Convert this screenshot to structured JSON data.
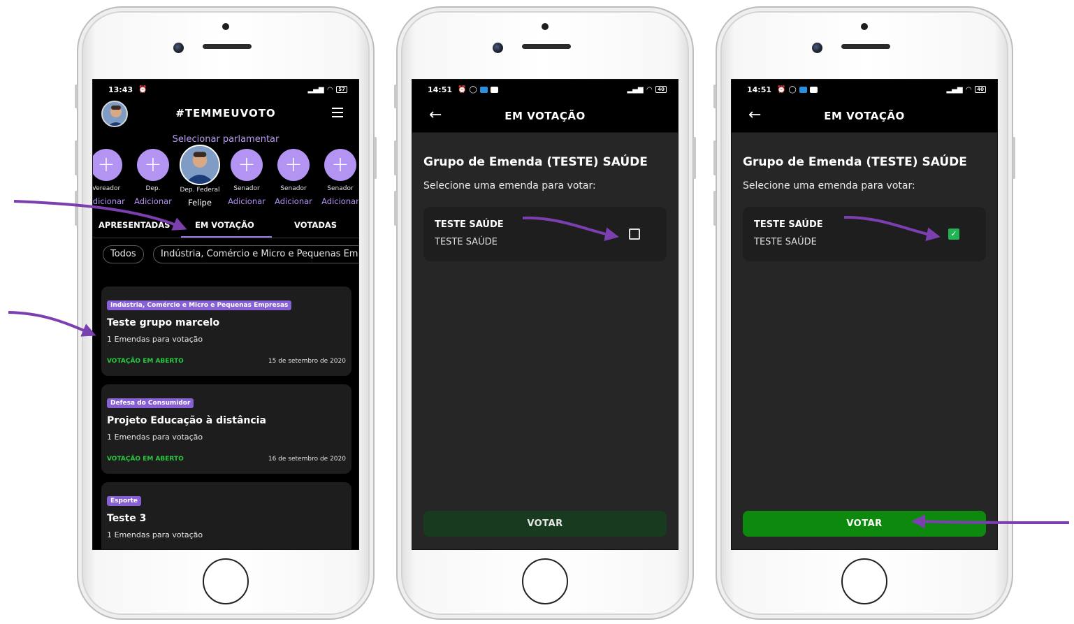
{
  "phone1": {
    "status": {
      "time": "13:43",
      "battery": "57"
    },
    "title": "#TEMMEUVOTO",
    "select_label": "Selecionar parlamentar",
    "parliamentarians": [
      {
        "role": "Vereador",
        "action": "Adicionar"
      },
      {
        "role": "Dep.",
        "action": "Adicionar"
      },
      {
        "role": "Dep. Federal",
        "action": "Felipe"
      },
      {
        "role": "Senador",
        "action": "Adicionar"
      },
      {
        "role": "Senador",
        "action": "Adicionar"
      },
      {
        "role": "Senador",
        "action": "Adicionar"
      }
    ],
    "tabs": [
      "APRESENTADAS",
      "EM VOTAÇÃO",
      "VOTADAS"
    ],
    "chips": [
      "Todos",
      "Indústria, Comércio e Micro e Pequenas Empresas"
    ],
    "cards": [
      {
        "tag": "Indústria, Comércio e Micro e Pequenas Empresas",
        "title": "Teste grupo marcelo",
        "subtitle": "1 Emendas para votação",
        "status": "VOTAÇÃO EM ABERTO",
        "date": "15 de setembro de 2020"
      },
      {
        "tag": "Defesa do Consumidor",
        "title": "Projeto Educação à distância",
        "subtitle": "1 Emendas para votação",
        "status": "VOTAÇÃO EM ABERTO",
        "date": "16 de setembro de 2020"
      },
      {
        "tag": "Esporte",
        "title": "Teste 3",
        "subtitle": "1 Emendas para votação",
        "status": "",
        "date": ""
      }
    ]
  },
  "phone2": {
    "status": {
      "time": "14:51",
      "battery": "40"
    },
    "back_icon": "←",
    "title": "EM VOTAÇÃO",
    "group_title": "Grupo de Emenda (TESTE) SAÚDE",
    "instruction": "Selecione uma emenda para votar:",
    "amendment": {
      "title": "TESTE SAÚDE",
      "subtitle": "TESTE SAÚDE",
      "checked": false
    },
    "vote_button": "VOTAR"
  },
  "phone3": {
    "status": {
      "time": "14:51",
      "battery": "40"
    },
    "back_icon": "←",
    "title": "EM VOTAÇÃO",
    "group_title": "Grupo de Emenda (TESTE) SAÚDE",
    "instruction": "Selecione uma emenda para votar:",
    "amendment": {
      "title": "TESTE SAÚDE",
      "subtitle": "TESTE SAÚDE",
      "checked": true,
      "check_glyph": "✓"
    },
    "vote_button": "VOTAR"
  },
  "colors": {
    "accent": "#9a7ce8",
    "arrow": "#7b3fb0",
    "success": "#27c93f",
    "vote_enabled": "#0d8a0d",
    "vote_disabled": "#183b20"
  }
}
